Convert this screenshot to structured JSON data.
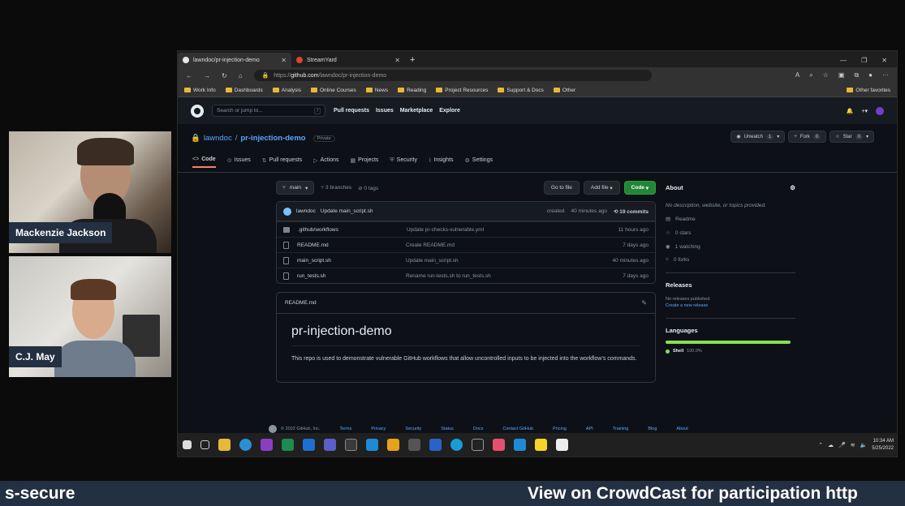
{
  "participants": [
    {
      "name": "Mackenzie Jackson"
    },
    {
      "name": "C.J. May"
    }
  ],
  "browser": {
    "tabs": [
      {
        "title": "lawndoc/pr-injection-demo",
        "active": true
      },
      {
        "title": "StreamYard",
        "active": false
      }
    ],
    "url_prefix": "https://",
    "url_host": "github.com",
    "url_path": "/lawndoc/pr-injection-demo",
    "bookmarks": [
      "Work Info",
      "Dashboards",
      "Analysis",
      "Online Courses",
      "News",
      "Reading",
      "Project Resources",
      "Support & Docs",
      "Other"
    ],
    "other_favorites": "Other favorites"
  },
  "github": {
    "search_placeholder": "Search or jump to...",
    "nav": [
      "Pull requests",
      "Issues",
      "Marketplace",
      "Explore"
    ],
    "owner": "lawndoc",
    "repo": "pr-injection-demo",
    "visibility": "Private",
    "actions": [
      {
        "label": "Unwatch",
        "count": "1"
      },
      {
        "label": "Fork",
        "count": "0"
      },
      {
        "label": "Star",
        "count": "0"
      }
    ],
    "repo_tabs": [
      "Code",
      "Issues",
      "Pull requests",
      "Actions",
      "Projects",
      "Security",
      "Insights",
      "Settings"
    ],
    "branch": "main",
    "branches": "3 branches",
    "tags": "0 tags",
    "go_to_file": "Go to file",
    "add_file": "Add file",
    "code_button": "Code",
    "latest_commit": {
      "author": "lawndoc",
      "message": "Update main_script.sh",
      "status": "created",
      "age": "40 minutes ago",
      "commits": "19 commits"
    },
    "files": [
      {
        "name": ".github/workflows",
        "type": "dir",
        "message": "Update pr-checks-vulnerable.yml",
        "age": "11 hours ago"
      },
      {
        "name": "README.md",
        "type": "file",
        "message": "Create README.md",
        "age": "7 days ago"
      },
      {
        "name": "main_script.sh",
        "type": "file",
        "message": "Update main_script.sh",
        "age": "40 minutes ago"
      },
      {
        "name": "run_tests.sh",
        "type": "file",
        "message": "Rename run-tests.sh to run_tests.sh",
        "age": "7 days ago"
      }
    ],
    "readme": {
      "filename": "README.md",
      "heading": "pr-injection-demo",
      "body": "This repo is used to demonstrate vulnerable GitHub workflows that allow uncontrolled inputs to be injected into the workflow's commands."
    },
    "about": {
      "title": "About",
      "description": "No description, website, or topics provided.",
      "items": [
        "Readme",
        "0 stars",
        "1 watching",
        "0 forks"
      ]
    },
    "releases": {
      "title": "Releases",
      "status": "No releases published",
      "link": "Create a new release"
    },
    "languages": {
      "title": "Languages",
      "items": [
        {
          "name": "Shell",
          "percent": "100.0%",
          "color": "#89e051"
        }
      ]
    },
    "footer": {
      "copyright": "© 2022 GitHub, Inc.",
      "links": [
        "Terms",
        "Privacy",
        "Security",
        "Status",
        "Docs",
        "Contact GitHub",
        "Pricing",
        "API",
        "Training",
        "Blog",
        "About"
      ]
    }
  },
  "taskbar": {
    "time": "10:34 AM",
    "date": "5/25/2022"
  },
  "banner": {
    "left_text": "s-secure",
    "right_text": "View on CrowdCast for participation http"
  },
  "colors": {
    "gh_bg": "#0d1117",
    "gh_header": "#161b22",
    "accent_link": "#58a6ff",
    "active_tab": "#f78166",
    "code_button": "#238636",
    "banner": "#233041"
  }
}
